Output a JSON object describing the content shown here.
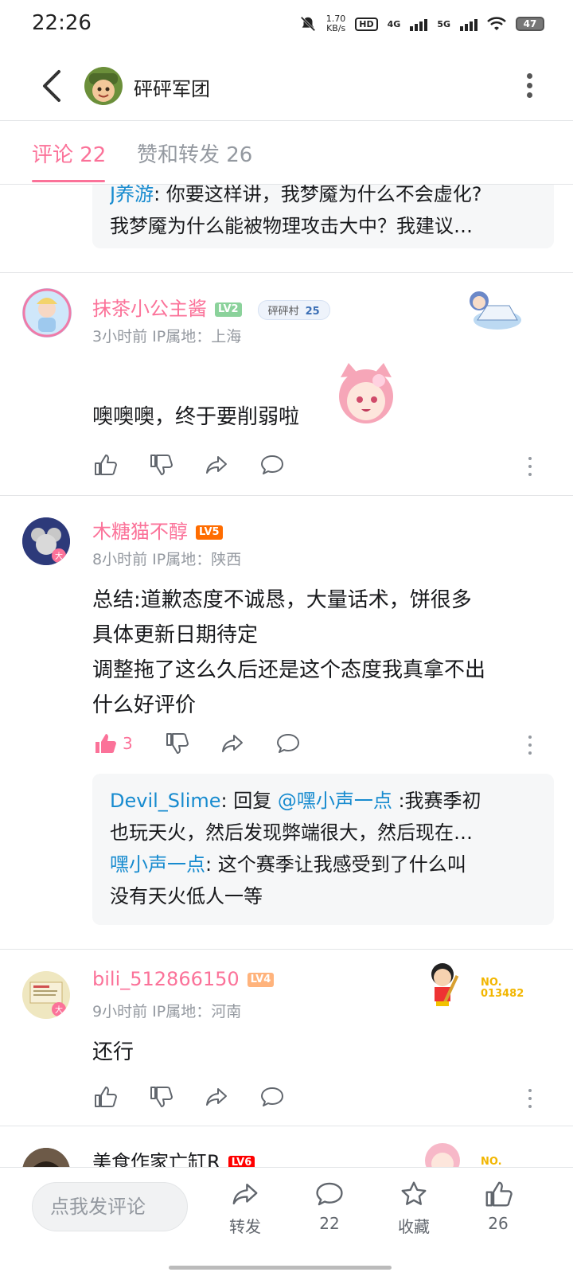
{
  "status_bar": {
    "time": "22:26",
    "speed_top": "1.70",
    "speed_bottom": "KB/s",
    "hd": "HD",
    "sim1": "4G",
    "sim2": "5G",
    "battery": "47"
  },
  "header": {
    "title": "砰砰军团"
  },
  "tabs": [
    {
      "label": "评论 22",
      "active": true
    },
    {
      "label": "赞和转发 26",
      "active": false
    }
  ],
  "top_reply": {
    "user": "J养游",
    "line1_rest": ": 你要这样讲，我梦魇为什么不会虚化?",
    "line2": "我梦魇为什么能被物理攻击大中？我建议…"
  },
  "comments": [
    {
      "author": "抹茶小公主酱",
      "level": "LV2",
      "fan_badge": "砰砰村",
      "fan_level": "25",
      "time": "3小时前",
      "ip": "IP属地：上海",
      "text": "噢噢噢，终于要削弱啦"
    },
    {
      "author": "木糖猫不醇",
      "level": "LV5",
      "time": "8小时前",
      "ip": "IP属地：陕西",
      "text_lines": [
        "总结:道歉态度不诚恳，大量话术，饼很多",
        "具体更新日期待定",
        "调整拖了这么久后还是这个态度我真拿不出",
        "什么好评价"
      ],
      "likes": "3",
      "replies": {
        "r1_user": "Devil_Slime",
        "r1_mid": ": 回复 ",
        "r1_mention": "@嘿小声一点",
        "r1_rest": " :我赛季初",
        "r1_line2": "也玩天火，然后发现弊端很大，然后现在…",
        "r2_user": "嘿小声一点",
        "r2_rest": ": 这个赛季让我感受到了什么叫",
        "r2_line2": "没有天火低人一等"
      }
    },
    {
      "author": "bili_512866150",
      "level": "LV4",
      "time": "9小时前",
      "ip": "IP属地：河南",
      "text": "还行",
      "decor_text": "NO. 013482"
    },
    {
      "author": "美食作家亡缸R",
      "level": "LV6",
      "decor_text": "NO."
    }
  ],
  "bottom_bar": {
    "input_placeholder": "点我发评论",
    "share_label": "转发",
    "comment_count": "22",
    "fav_label": "收藏",
    "like_count": "26"
  },
  "colors": {
    "accent": "#fb7299",
    "link": "#178bcf",
    "muted": "#9499a0"
  }
}
